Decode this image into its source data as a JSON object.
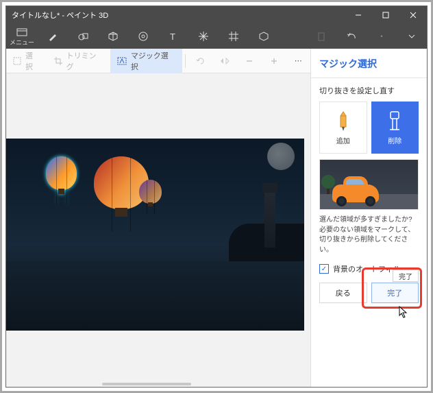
{
  "titlebar": {
    "title": "タイトルなし* - ペイント 3D"
  },
  "ribbon": {
    "menu_label": "メニュー"
  },
  "subtoolbar": {
    "select_label": "選択",
    "trimming_label": "トリミング",
    "magic_label": "マジック選択"
  },
  "panel": {
    "heading": "マジック選択",
    "subhead": "切り抜きを設定し直す",
    "add_label": "追加",
    "remove_label": "削除",
    "hint": "選んだ領域が多すぎましたか? 必要のない領域をマークして、切り抜きから削除してください。",
    "autofill_label": "背景のオートフィル",
    "back_label": "戻る",
    "done_label": "完了",
    "tooltip": "完了"
  }
}
